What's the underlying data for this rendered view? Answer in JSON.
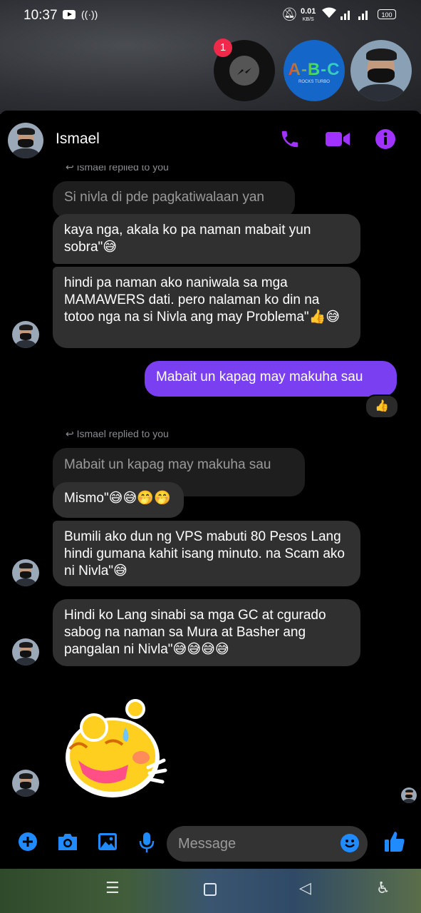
{
  "status_bar": {
    "time": "10:37",
    "net_speed": "0.01",
    "net_unit": "KB/S",
    "battery": "100"
  },
  "chat_heads": {
    "messenger_badge": "1",
    "abc_text": "A-B-C",
    "abc_sub": "ROCKS TURBO"
  },
  "header": {
    "contact_name": "Ismael"
  },
  "messages": {
    "reply_note_1": "Ismael replied to you",
    "quoted_1": "Si nivla di pde pagkatiwalaan yan",
    "msg_1": "kaya nga, akala ko pa naman mabait yun sobra\"😅",
    "msg_2": "hindi pa naman ako naniwala sa mga MAMAWERS dati. pero nalaman ko din na totoo nga na si Nivla ang may Problema\"👍😅",
    "my_msg": "Mabait un kapag may makuha sau",
    "reaction": "👍",
    "reply_note_2": "Ismael replied to you",
    "quoted_2": "Mabait un kapag may makuha sau",
    "msg_3": "Mismo\"😅😅🤭🤭",
    "msg_4": "Bumili ako dun ng VPS mabuti 80 Pesos Lang hindi gumana kahit isang minuto. na Scam ako ni Nivla\"😅",
    "msg_5": "Hindi ko Lang sinabi sa mga GC at cgurado sabog na naman sa Mura at Basher ang pangalan ni Nivla\"😅😅😅😅"
  },
  "composer": {
    "placeholder": "Message"
  }
}
